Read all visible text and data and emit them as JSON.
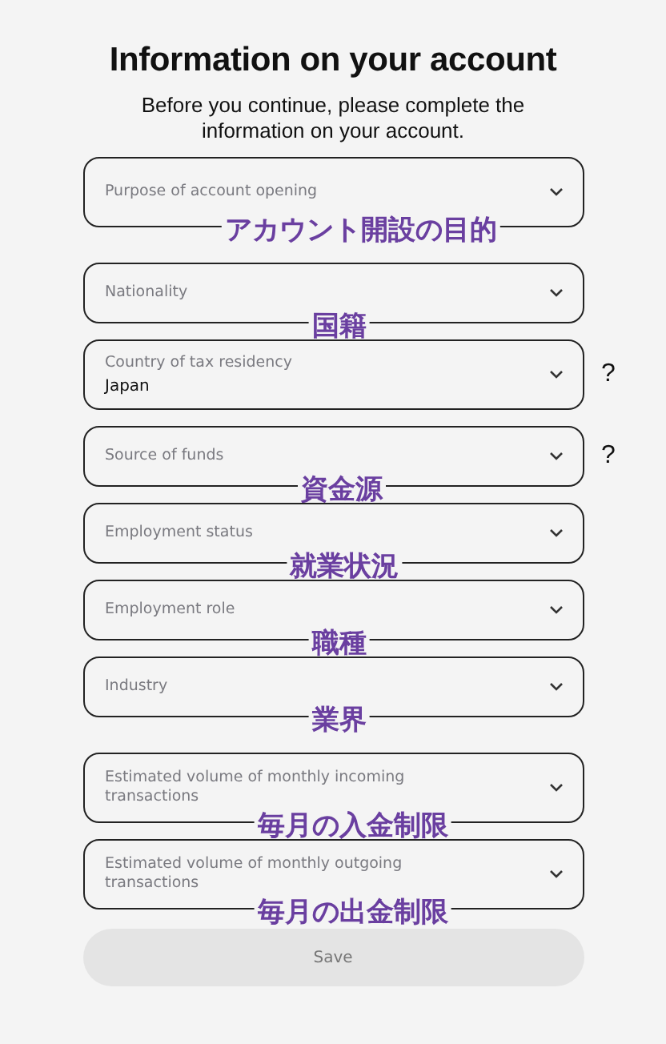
{
  "title": "Information on your account",
  "subtitle": "Before you continue, please complete the information on your account.",
  "fields": [
    {
      "label": "Purpose of account opening",
      "annotation": "アカウント開設の目的"
    },
    {
      "label": "Nationality",
      "annotation": "国籍"
    },
    {
      "label": "Country of tax residency",
      "value": "Japan",
      "help_text": "?"
    },
    {
      "label": "Source of funds",
      "help_text": "?",
      "annotation": "資金源"
    },
    {
      "label": "Employment status",
      "annotation": "就業状況"
    },
    {
      "label": "Employment role",
      "annotation": "職種"
    },
    {
      "label": "Industry",
      "annotation": "業界"
    },
    {
      "label": "Estimated volume of monthly incoming transactions",
      "annotation": "毎月の入金制限"
    },
    {
      "label": "Estimated volume of monthly outgoing transactions",
      "annotation": "毎月の出金制限"
    }
  ],
  "save_button": {
    "label": "Save",
    "disabled": true
  }
}
